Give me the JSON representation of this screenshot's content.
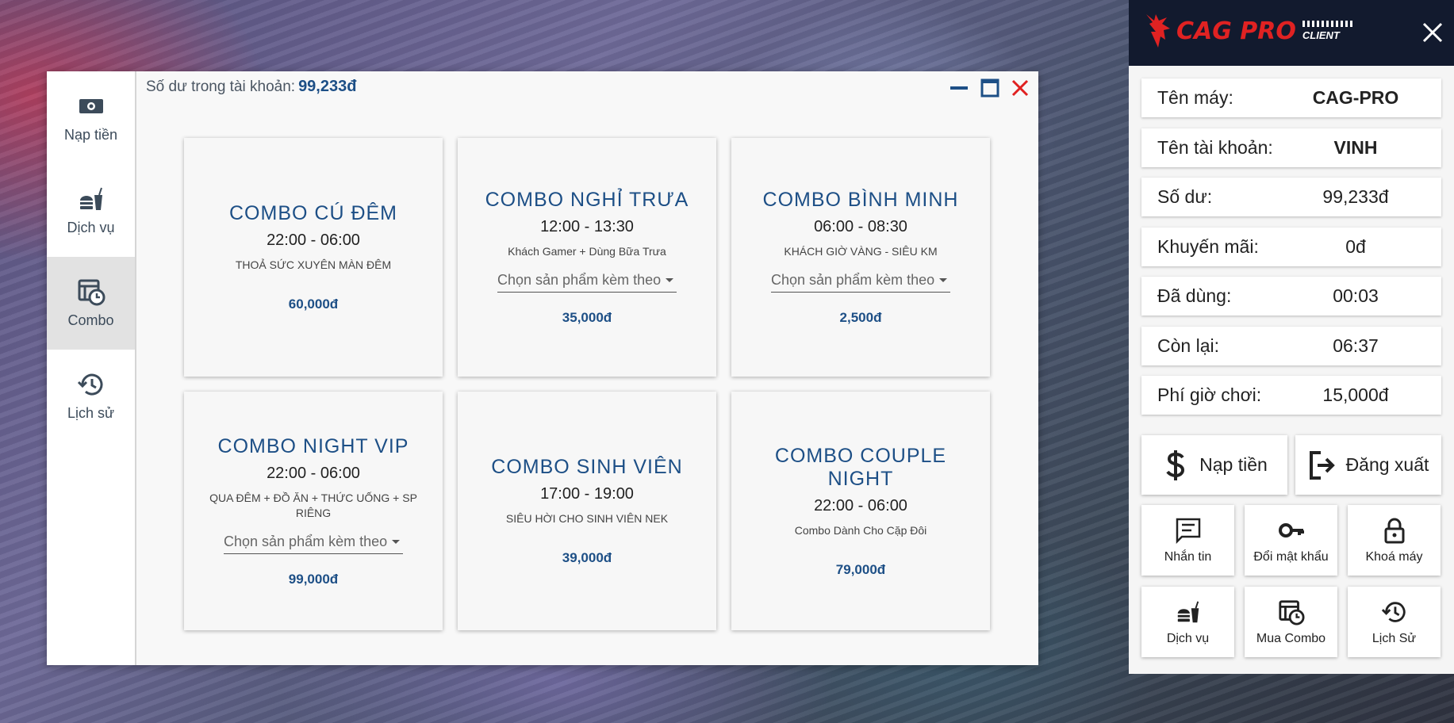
{
  "main": {
    "balance_label": "Số dư trong tài khoản:",
    "balance_value": "99,233đ",
    "nav": [
      {
        "label": "Nạp tiền",
        "icon": "cash-icon"
      },
      {
        "label": "Dịch vụ",
        "icon": "food-drink-icon"
      },
      {
        "label": "Combo",
        "icon": "combo-calendar-icon",
        "active": true
      },
      {
        "label": "Lịch sử",
        "icon": "history-icon"
      }
    ],
    "select_placeholder": "Chọn sản phẩm kèm theo",
    "combos": [
      {
        "title": "COMBO CÚ ĐÊM",
        "time": "22:00 - 06:00",
        "desc": "THOẢ SỨC XUYÊN MÀN ĐÊM",
        "has_select": false,
        "price": "60,000đ"
      },
      {
        "title": "COMBO NGHỈ TRƯA",
        "time": "12:00 - 13:30",
        "desc": "Khách Gamer + Dùng Bữa Trưa",
        "has_select": true,
        "price": "35,000đ"
      },
      {
        "title": "COMBO BÌNH MINH",
        "time": "06:00 - 08:30",
        "desc": "KHÁCH GIỜ VÀNG - SIÊU KM",
        "has_select": true,
        "price": "2,500đ"
      },
      {
        "title": "COMBO NIGHT VIP",
        "time": "22:00 - 06:00",
        "desc": "QUA ĐÊM + ĐỒ ĂN + THỨC UỐNG + SP RIÊNG",
        "has_select": true,
        "price": "99,000đ"
      },
      {
        "title": "COMBO SINH VIÊN",
        "time": "17:00 - 19:00",
        "desc": "SIÊU HỜI CHO SINH VIÊN NEK",
        "has_select": false,
        "price": "39,000đ"
      },
      {
        "title": "COMBO COUPLE NIGHT",
        "time": "22:00 - 06:00",
        "desc": "Combo Dành Cho Cặp Đôi",
        "has_select": false,
        "price": "79,000đ"
      }
    ],
    "colors": {
      "accent": "#1d4f86",
      "close": "#e02020"
    }
  },
  "panel": {
    "logo": {
      "brand": "CAG PRO",
      "sub": "CLIENT"
    },
    "rows": [
      {
        "label": "Tên máy:",
        "value": "CAG-PRO",
        "bold": true
      },
      {
        "label": "Tên tài khoản:",
        "value": "VINH",
        "bold": true
      },
      {
        "label": "Số dư:",
        "value": "99,233đ",
        "bold": false
      },
      {
        "label": "Khuyến mãi:",
        "value": "0đ",
        "bold": false
      },
      {
        "label": "Đã dùng:",
        "value": "00:03",
        "bold": false
      },
      {
        "label": "Còn lại:",
        "value": "06:37",
        "bold": false
      },
      {
        "label": "Phí giờ chơi:",
        "value": "15,000đ",
        "bold": false
      }
    ],
    "topup_label": "Nạp tiền",
    "logout_label": "Đăng xuất",
    "buttons": [
      {
        "label": "Nhắn tin",
        "icon": "message-icon"
      },
      {
        "label": "Đổi mật khẩu",
        "icon": "key-icon"
      },
      {
        "label": "Khoá máy",
        "icon": "lock-icon"
      },
      {
        "label": "Dịch vụ",
        "icon": "food-drink-icon"
      },
      {
        "label": "Mua Combo",
        "icon": "combo-calendar-icon"
      },
      {
        "label": "Lịch Sử",
        "icon": "history-icon"
      }
    ],
    "colors": {
      "header": "#121a2e",
      "brand": "#e02222"
    }
  }
}
